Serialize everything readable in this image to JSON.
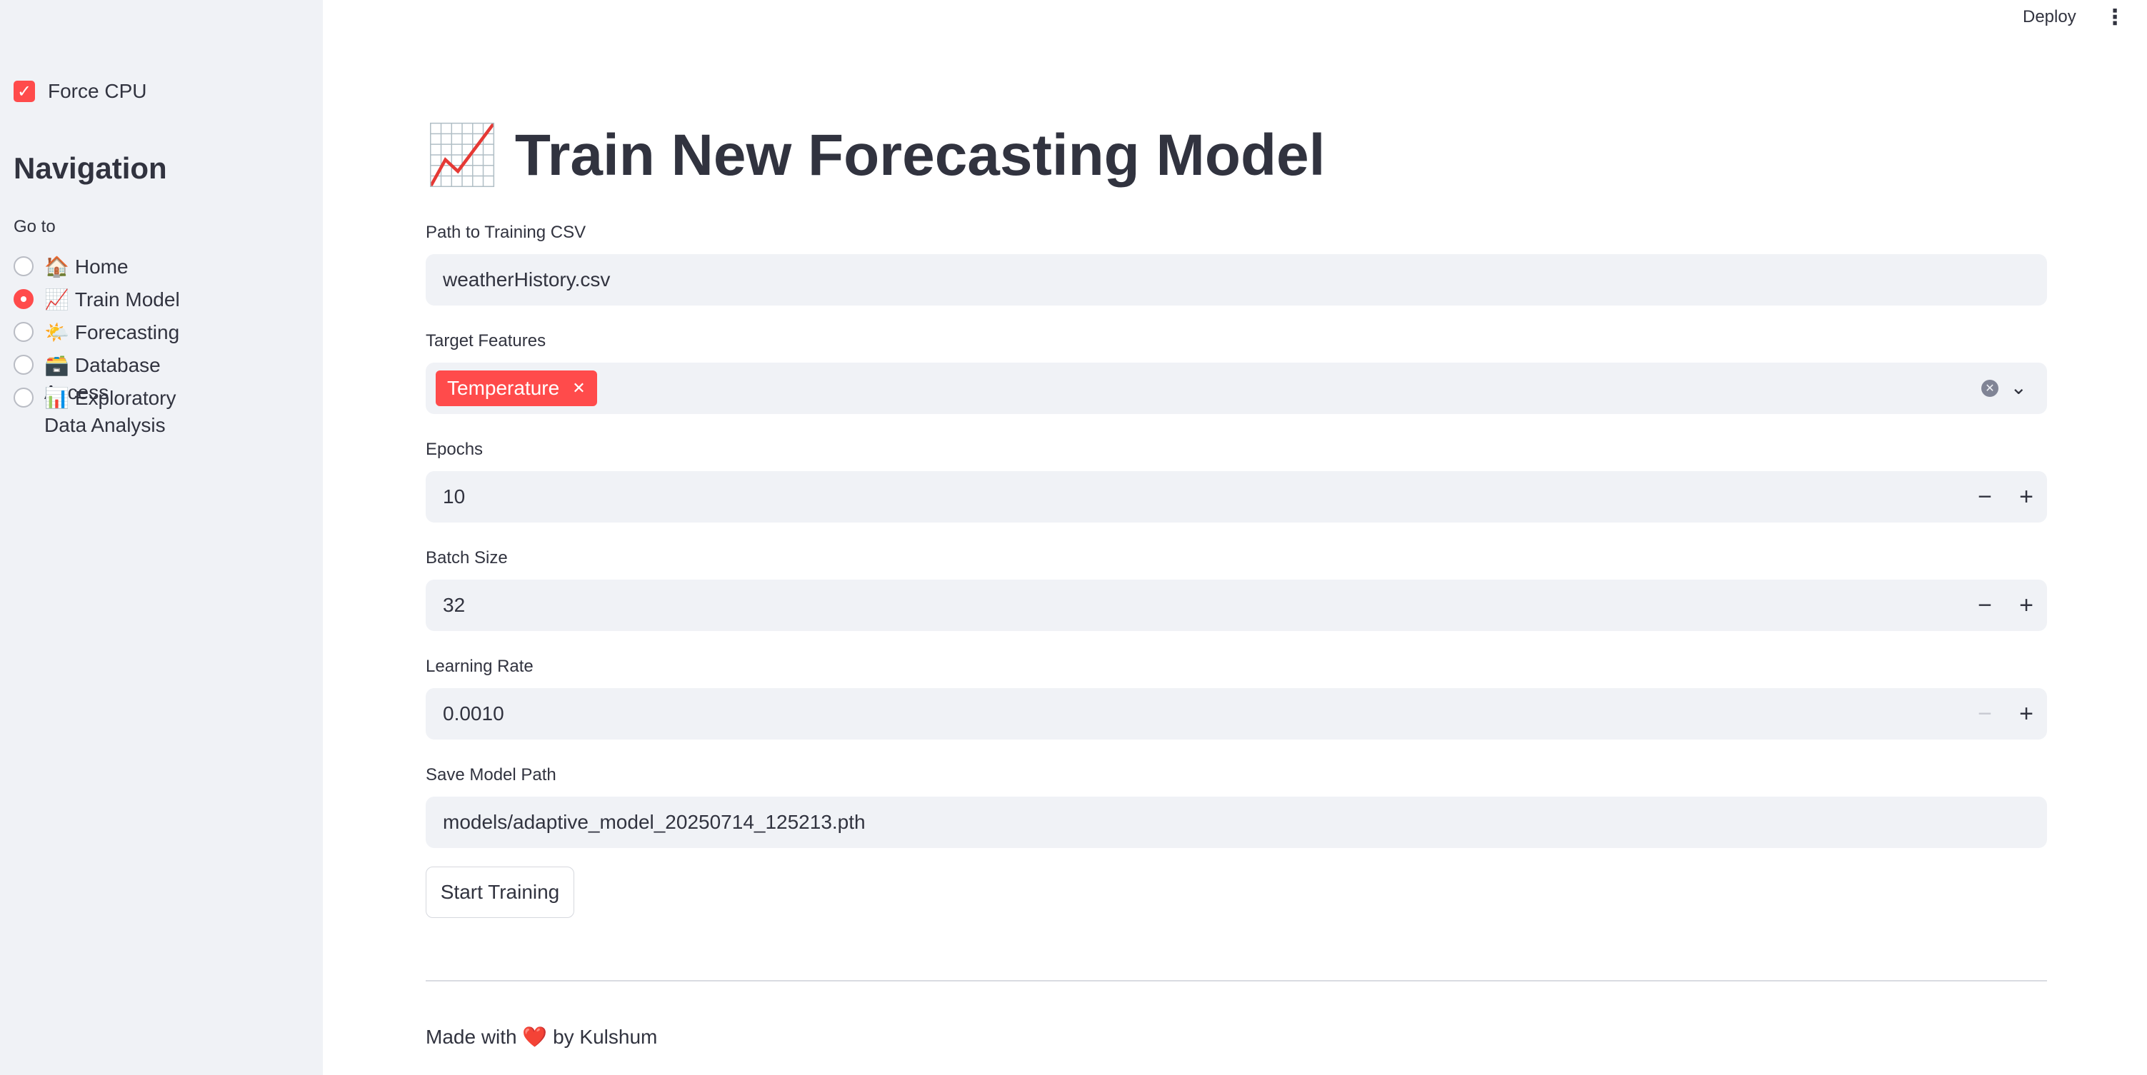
{
  "sidebar": {
    "force_cpu": {
      "label": "Force CPU",
      "checked": true
    },
    "nav_title": "Navigation",
    "goto_label": "Go to",
    "items": [
      {
        "emoji": "🏠",
        "label": "Home",
        "selected": false
      },
      {
        "emoji": "📈",
        "label": "Train Model",
        "selected": true
      },
      {
        "emoji": "🌤️",
        "label": "Forecasting",
        "selected": false
      },
      {
        "emoji": "🗃️",
        "label": "Database Access",
        "selected": false
      },
      {
        "emoji": "📊",
        "label": "Exploratory Data Analysis",
        "selected": false
      }
    ]
  },
  "topbar": {
    "deploy": "Deploy",
    "menu_icon": "more-vertical-icon"
  },
  "main": {
    "title": "📈 Train New Forecasting Model",
    "csv": {
      "label": "Path to Training CSV",
      "value": "weatherHistory.csv"
    },
    "targets": {
      "label": "Target Features",
      "tag": "Temperature",
      "tag_remove": "✕"
    },
    "epochs": {
      "label": "Epochs",
      "value": "10"
    },
    "batch": {
      "label": "Batch Size",
      "value": "32"
    },
    "lr": {
      "label": "Learning Rate",
      "value": "0.0010"
    },
    "save_path": {
      "label": "Save Model Path",
      "value": "models/adaptive_model_20250714_125213.pth"
    },
    "start_button": "Start Training",
    "stepper": {
      "minus": "−",
      "plus": "+"
    }
  },
  "footer": {
    "prefix": "Made with",
    "heart": "❤️",
    "suffix": "by Kulshum"
  },
  "colors": {
    "accent": "#ff4b4b",
    "sidebar_bg": "#f0f2f6",
    "text": "#31333f"
  }
}
